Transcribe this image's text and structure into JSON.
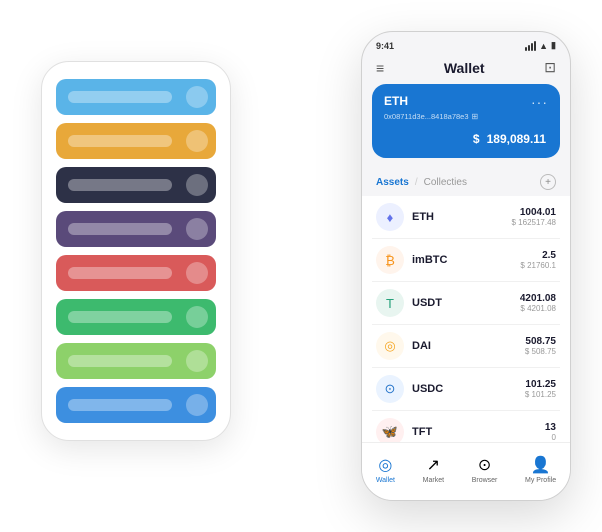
{
  "bgPhone": {
    "cards": [
      {
        "color": "#5ab4e8",
        "iconChar": "◆"
      },
      {
        "color": "#e8a83a",
        "iconChar": "◆"
      },
      {
        "color": "#2d3147",
        "iconChar": "◆"
      },
      {
        "color": "#5a4a7a",
        "iconChar": "◆"
      },
      {
        "color": "#d95a5a",
        "iconChar": "◆"
      },
      {
        "color": "#3dba6e",
        "iconChar": "◆"
      },
      {
        "color": "#8dd16a",
        "iconChar": "◆"
      },
      {
        "color": "#3d8fe0",
        "iconChar": "◆"
      }
    ]
  },
  "fgPhone": {
    "statusBar": {
      "time": "9:41",
      "signal": "●●●",
      "wifi": "wifi",
      "battery": "battery"
    },
    "header": {
      "menuIcon": "≡",
      "title": "Wallet",
      "expandIcon": "⊡"
    },
    "ethCard": {
      "label": "ETH",
      "dotsMenu": "···",
      "address": "0x08711d3e...8418a78e3",
      "copyIcon": "⊞",
      "balanceSymbol": "$",
      "balance": "189,089.11"
    },
    "assetsSection": {
      "activeTab": "Assets",
      "separator": "/",
      "inactiveTab": "Collecties",
      "addIcon": "+"
    },
    "assets": [
      {
        "symbol": "ETH",
        "iconBg": "#ecf0ff",
        "iconColor": "#6272ea",
        "iconChar": "♦",
        "amountPrimary": "1004.01",
        "amountSecondary": "$ 162517.48"
      },
      {
        "symbol": "imBTC",
        "iconBg": "#fff4ec",
        "iconColor": "#f7931a",
        "iconChar": "₿",
        "amountPrimary": "2.5",
        "amountSecondary": "$ 21760.1"
      },
      {
        "symbol": "USDT",
        "iconBg": "#e8f5f0",
        "iconColor": "#26a17b",
        "iconChar": "T",
        "amountPrimary": "4201.08",
        "amountSecondary": "$ 4201.08"
      },
      {
        "symbol": "DAI",
        "iconBg": "#fff8ec",
        "iconColor": "#f5a623",
        "iconChar": "◎",
        "amountPrimary": "508.75",
        "amountSecondary": "$ 508.75"
      },
      {
        "symbol": "USDC",
        "iconBg": "#eaf3ff",
        "iconColor": "#2775ca",
        "iconChar": "⊙",
        "amountPrimary": "101.25",
        "amountSecondary": "$ 101.25"
      },
      {
        "symbol": "TFT",
        "iconBg": "#fff0f0",
        "iconColor": "#e05c5c",
        "iconChar": "🦋",
        "amountPrimary": "13",
        "amountSecondary": "0"
      }
    ],
    "bottomNav": [
      {
        "label": "Wallet",
        "icon": "◎",
        "active": true
      },
      {
        "label": "Market",
        "icon": "📈",
        "active": false
      },
      {
        "label": "Browser",
        "icon": "👤",
        "active": false
      },
      {
        "label": "My Profile",
        "icon": "👤",
        "active": false
      }
    ]
  }
}
